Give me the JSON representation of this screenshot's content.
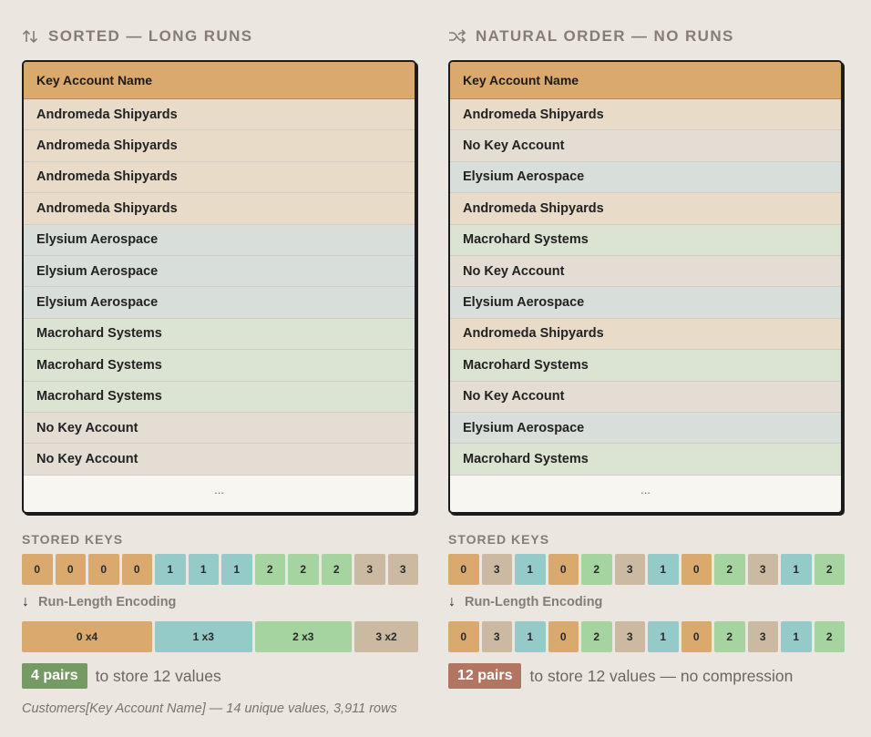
{
  "colors": {
    "key0": "#d9a96d",
    "key1": "#94cbc8",
    "key2": "#a6d4a0",
    "key3": "#cbb9a2",
    "good_badge": "#759a63",
    "bad_badge": "#b27561"
  },
  "left": {
    "icon": "sort-arrows-icon",
    "title": "SORTED — LONG RUNS",
    "table_header": "Key Account Name",
    "rows": [
      {
        "name": "Andromeda Shipyards",
        "key": 0
      },
      {
        "name": "Andromeda Shipyards",
        "key": 0
      },
      {
        "name": "Andromeda Shipyards",
        "key": 0
      },
      {
        "name": "Andromeda Shipyards",
        "key": 0
      },
      {
        "name": "Elysium Aerospace",
        "key": 1
      },
      {
        "name": "Elysium Aerospace",
        "key": 1
      },
      {
        "name": "Elysium Aerospace",
        "key": 1
      },
      {
        "name": "Macrohard Systems",
        "key": 2
      },
      {
        "name": "Macrohard Systems",
        "key": 2
      },
      {
        "name": "Macrohard Systems",
        "key": 2
      },
      {
        "name": "No Key Account",
        "key": 3
      },
      {
        "name": "No Key Account",
        "key": 3
      }
    ],
    "table_footer": "...",
    "stored_keys_label": "STORED KEYS",
    "stored_keys": [
      "0",
      "0",
      "0",
      "0",
      "1",
      "1",
      "1",
      "2",
      "2",
      "2",
      "3",
      "3"
    ],
    "rle_label": "Run-Length Encoding",
    "rle_pairs": [
      {
        "label": "0 x4",
        "key": 0,
        "count": 4
      },
      {
        "label": "1 x3",
        "key": 1,
        "count": 3
      },
      {
        "label": "2 x3",
        "key": 2,
        "count": 3
      },
      {
        "label": "3 x2",
        "key": 3,
        "count": 2
      }
    ],
    "badge": "4 pairs",
    "summary_text": "to store 12 values"
  },
  "right": {
    "icon": "shuffle-icon",
    "title": "NATURAL ORDER — NO RUNS",
    "table_header": "Key Account Name",
    "rows": [
      {
        "name": "Andromeda Shipyards",
        "key": 0
      },
      {
        "name": "No Key Account",
        "key": 3
      },
      {
        "name": "Elysium Aerospace",
        "key": 1
      },
      {
        "name": "Andromeda Shipyards",
        "key": 0
      },
      {
        "name": "Macrohard Systems",
        "key": 2
      },
      {
        "name": "No Key Account",
        "key": 3
      },
      {
        "name": "Elysium Aerospace",
        "key": 1
      },
      {
        "name": "Andromeda Shipyards",
        "key": 0
      },
      {
        "name": "Macrohard Systems",
        "key": 2
      },
      {
        "name": "No Key Account",
        "key": 3
      },
      {
        "name": "Elysium Aerospace",
        "key": 1
      },
      {
        "name": "Macrohard Systems",
        "key": 2
      }
    ],
    "table_footer": "...",
    "stored_keys_label": "STORED KEYS",
    "stored_keys": [
      "0",
      "3",
      "1",
      "0",
      "2",
      "3",
      "1",
      "0",
      "2",
      "3",
      "1",
      "2"
    ],
    "rle_label": "Run-Length Encoding",
    "rle_pairs": [
      {
        "label": "0",
        "key": 0,
        "count": 1
      },
      {
        "label": "3",
        "key": 3,
        "count": 1
      },
      {
        "label": "1",
        "key": 1,
        "count": 1
      },
      {
        "label": "0",
        "key": 0,
        "count": 1
      },
      {
        "label": "2",
        "key": 2,
        "count": 1
      },
      {
        "label": "3",
        "key": 3,
        "count": 1
      },
      {
        "label": "1",
        "key": 1,
        "count": 1
      },
      {
        "label": "0",
        "key": 0,
        "count": 1
      },
      {
        "label": "2",
        "key": 2,
        "count": 1
      },
      {
        "label": "3",
        "key": 3,
        "count": 1
      },
      {
        "label": "1",
        "key": 1,
        "count": 1
      },
      {
        "label": "2",
        "key": 2,
        "count": 1
      }
    ],
    "badge": "12 pairs",
    "summary_text": "to store 12 values — no compression"
  },
  "footnote": "Customers[Key Account Name] — 14 unique values, 3,911 rows"
}
